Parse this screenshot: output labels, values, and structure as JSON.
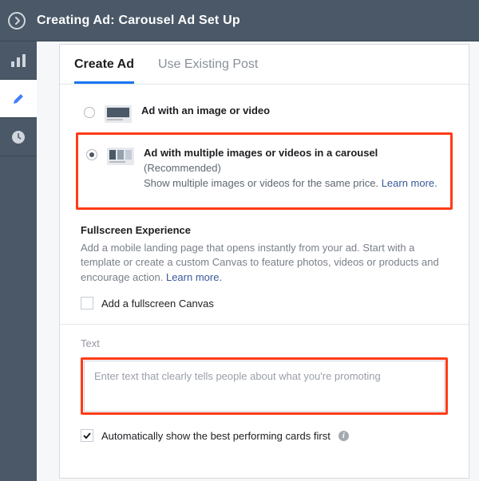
{
  "header": {
    "title": "Creating Ad: Carousel Ad Set Up"
  },
  "tabs": {
    "create": "Create Ad",
    "existing": "Use Existing Post"
  },
  "ad_options": {
    "single": {
      "title": "Ad with an image or video"
    },
    "carousel": {
      "title": "Ad with multiple images or videos in a carousel",
      "recommended": "(Recommended)",
      "desc": "Show multiple images or videos for the same price. ",
      "learn_more": "Learn more."
    }
  },
  "fullscreen": {
    "heading": "Fullscreen Experience",
    "desc": "Add a mobile landing page that opens instantly from your ad. Start with a template or create a custom Canvas to feature photos, videos or products and encourage action. ",
    "learn_more": "Learn more.",
    "checkbox_label": "Add a fullscreen Canvas"
  },
  "text_section": {
    "label": "Text",
    "placeholder": "Enter text that clearly tells people about what you're promoting"
  },
  "auto_cards": {
    "label": "Automatically show the best performing cards first"
  }
}
